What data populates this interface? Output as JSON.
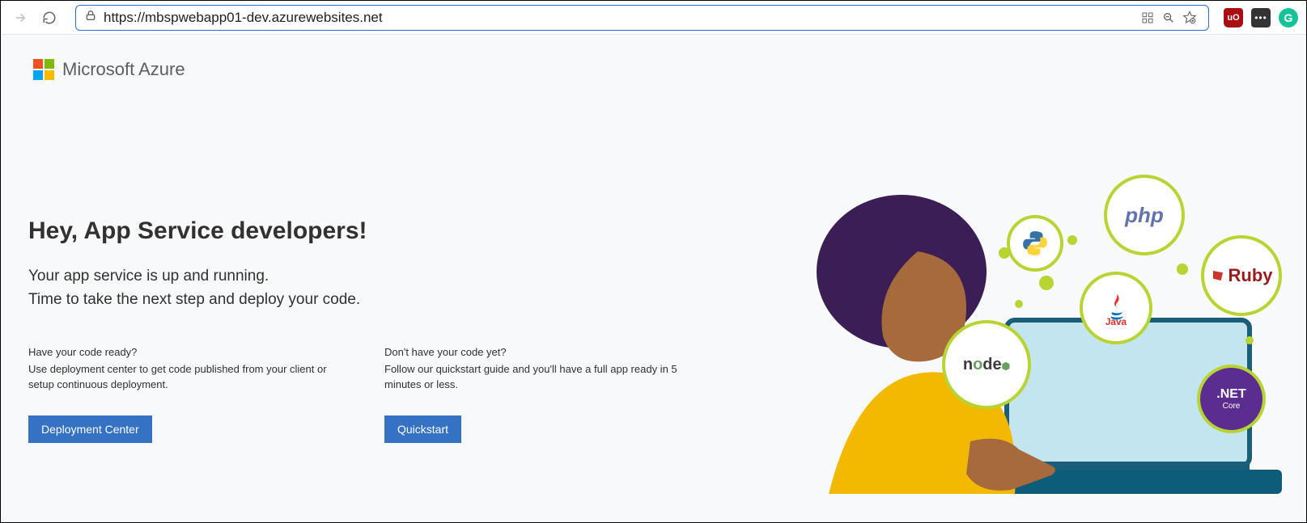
{
  "browser": {
    "url": "https://mbspwebapp01-dev.azurewebsites.net",
    "extensions": {
      "ublock_label": "uO",
      "grammarly_label": "G"
    }
  },
  "header": {
    "brand": "Microsoft Azure"
  },
  "hero": {
    "title": "Hey, App Service developers!",
    "subtitle_line1": "Your app service is up and running.",
    "subtitle_line2": "Time to take the next step and deploy your code."
  },
  "columns": {
    "left": {
      "question": "Have your code ready?",
      "desc": "Use deployment center to get code published from your client or setup continuous deployment.",
      "button": "Deployment Center"
    },
    "right": {
      "question": "Don't have your code yet?",
      "desc": "Follow our quickstart guide and you'll have a full app ready in 5 minutes or less.",
      "button": "Quickstart"
    }
  },
  "illustration": {
    "bubbles": {
      "php": "php",
      "ruby": "Ruby",
      "java": "Java",
      "node": "node",
      "python": "python",
      "dotnet": ".NET"
    }
  }
}
